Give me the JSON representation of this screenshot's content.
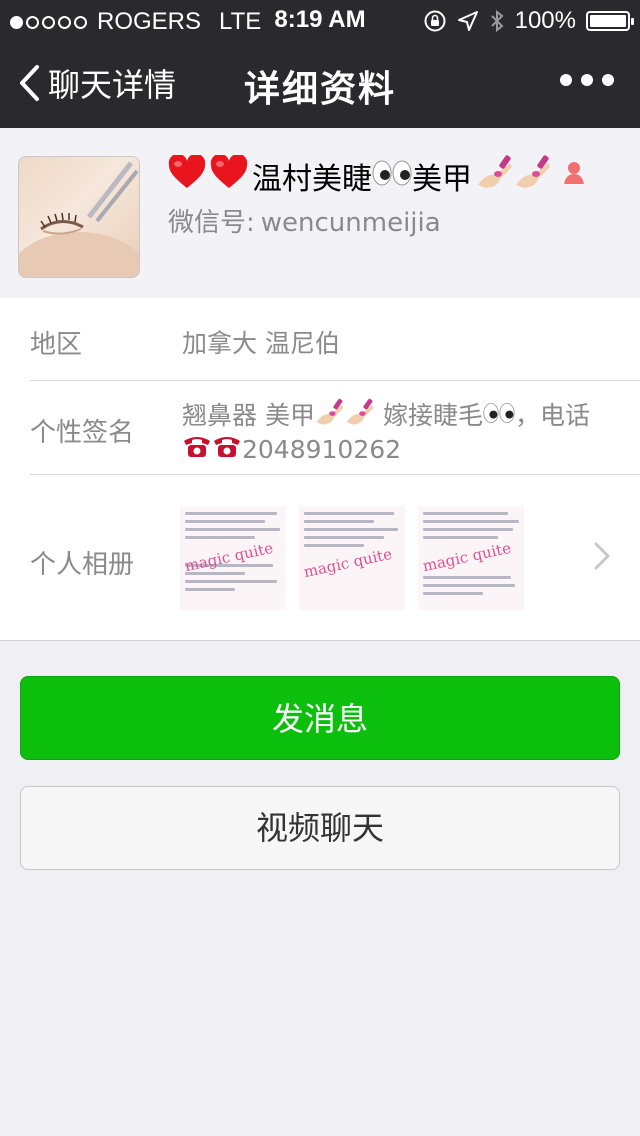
{
  "status_bar": {
    "carrier": "ROGERS",
    "network": "LTE",
    "time": "8:19 AM",
    "battery": "100%",
    "signal_bars": 1,
    "signal_total": 5
  },
  "nav": {
    "back_label": "聊天详情",
    "title": "详细资料"
  },
  "profile": {
    "name_text_1": "温村美睫",
    "name_text_2": "美甲",
    "wechat_id_label": "微信号:",
    "wechat_id": "wencunmeijia"
  },
  "details": {
    "region_label": "地区",
    "region_value": "加拿大 温尼伯",
    "signature_label": "个性签名",
    "signature_part1": "翘鼻器 美甲",
    "signature_part2": "嫁接睫毛",
    "signature_part3": "，电话",
    "signature_phone": "2048910262",
    "album_label": "个人相册",
    "album_watermark": "magic quite"
  },
  "buttons": {
    "send_message": "发消息",
    "video_chat": "视频聊天"
  },
  "colors": {
    "nav_bg": "#2a2a2e",
    "primary_green": "#0cbf0c",
    "page_bg": "#efeff4"
  }
}
